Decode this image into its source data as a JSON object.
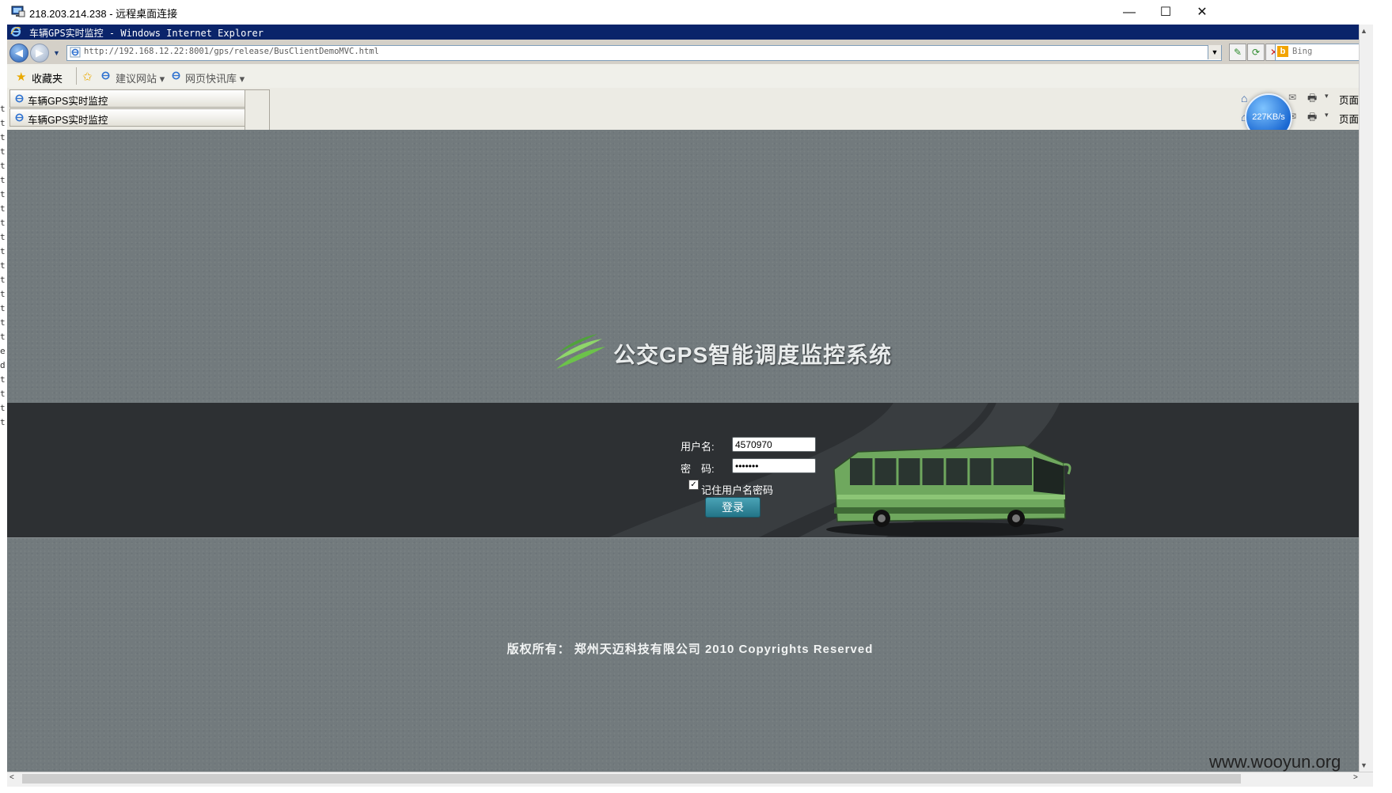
{
  "rdp_window": {
    "title": "218.203.214.238 - 远程桌面连接",
    "minimize_symbol": "—",
    "maximize_symbol": "☐",
    "close_symbol": "✕"
  },
  "browser": {
    "title": "车辆GPS实时监控 - Windows Internet Explorer",
    "address": "http://192.168.12.22:8001/gps/release/BusClientDemoMVC.html",
    "search_placeholder": "Bing",
    "favorites_label": "收藏夹",
    "fav_links": [
      "建议网站 ▾",
      "网页快讯库 ▾"
    ],
    "tabs": [
      "车辆GPS实时监控",
      "车辆GPS实时监控"
    ],
    "page_menu_label": "页面(",
    "speed_badge": "227KB/s"
  },
  "login_page": {
    "system_title": "公交GPS智能调度监控系统",
    "username_label": "用户名:",
    "username_value": "4570970",
    "password_label": "密　码:",
    "password_value": "•••••••",
    "remember_label": "记住用户名密码",
    "remember_checked": true,
    "login_button": "登录",
    "copyright": "版权所有： 郑州天迈科技有限公司  2010 Copyrights Reserved"
  },
  "desktop_strip_chars": [
    "t",
    "t",
    "t",
    "t",
    "t",
    "t",
    "t",
    "t",
    "t",
    "t",
    "t",
    "t",
    "t",
    "t",
    "t",
    "t",
    "t",
    "e",
    "d",
    "t",
    "t",
    "t",
    "t"
  ],
  "watermark": "www.wooyun.org",
  "colors": {
    "page_bg": "#727a7d",
    "login_band": "#2d3033",
    "button": "#2c8196",
    "ie_title_bg": "#0a246a"
  }
}
